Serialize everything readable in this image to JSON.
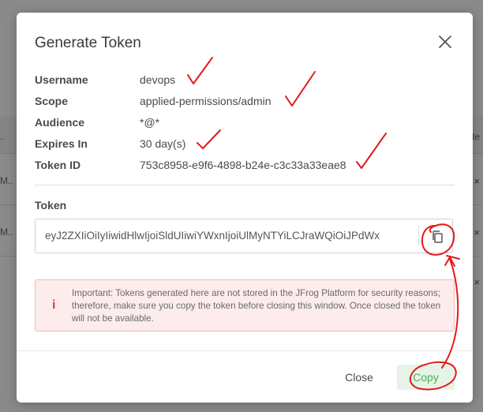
{
  "background": {
    "left_fragments": [
      "..",
      "M..",
      "M.."
    ],
    "right_fragment": "te",
    "close_marks": [
      "×",
      "×",
      "×"
    ]
  },
  "modal": {
    "title": "Generate Token",
    "info": [
      {
        "label": "Username",
        "value": "devops"
      },
      {
        "label": "Scope",
        "value": "applied-permissions/admin"
      },
      {
        "label": "Audience",
        "value": "*@*"
      },
      {
        "label": "Expires In",
        "value": "30 day(s)"
      },
      {
        "label": "Token ID",
        "value": "753c8958-e9f6-4898-b24e-c3c33a33eae8"
      }
    ],
    "token": {
      "label": "Token",
      "value": "eyJ2ZXIiOiIyIiwidHlwIjoiSldUIiwiYWxnIjoiUlMyNTYiLCJraWQiOiJPdWx"
    },
    "alert": {
      "icon": "i",
      "text": "Important: Tokens generated here are not stored in the JFrog Platform for security reasons; therefore, make sure you copy the token before closing this window. Once closed the token will not be available."
    },
    "footer": {
      "close_label": "Close",
      "copy_label": "Copy"
    }
  },
  "colors": {
    "accent_green": "#4caf50",
    "alert_red": "#e0393e",
    "annotation_red": "#e31a1a"
  },
  "icons": {
    "close": "close-icon",
    "copy": "copy-icon",
    "alert": "info-icon"
  }
}
